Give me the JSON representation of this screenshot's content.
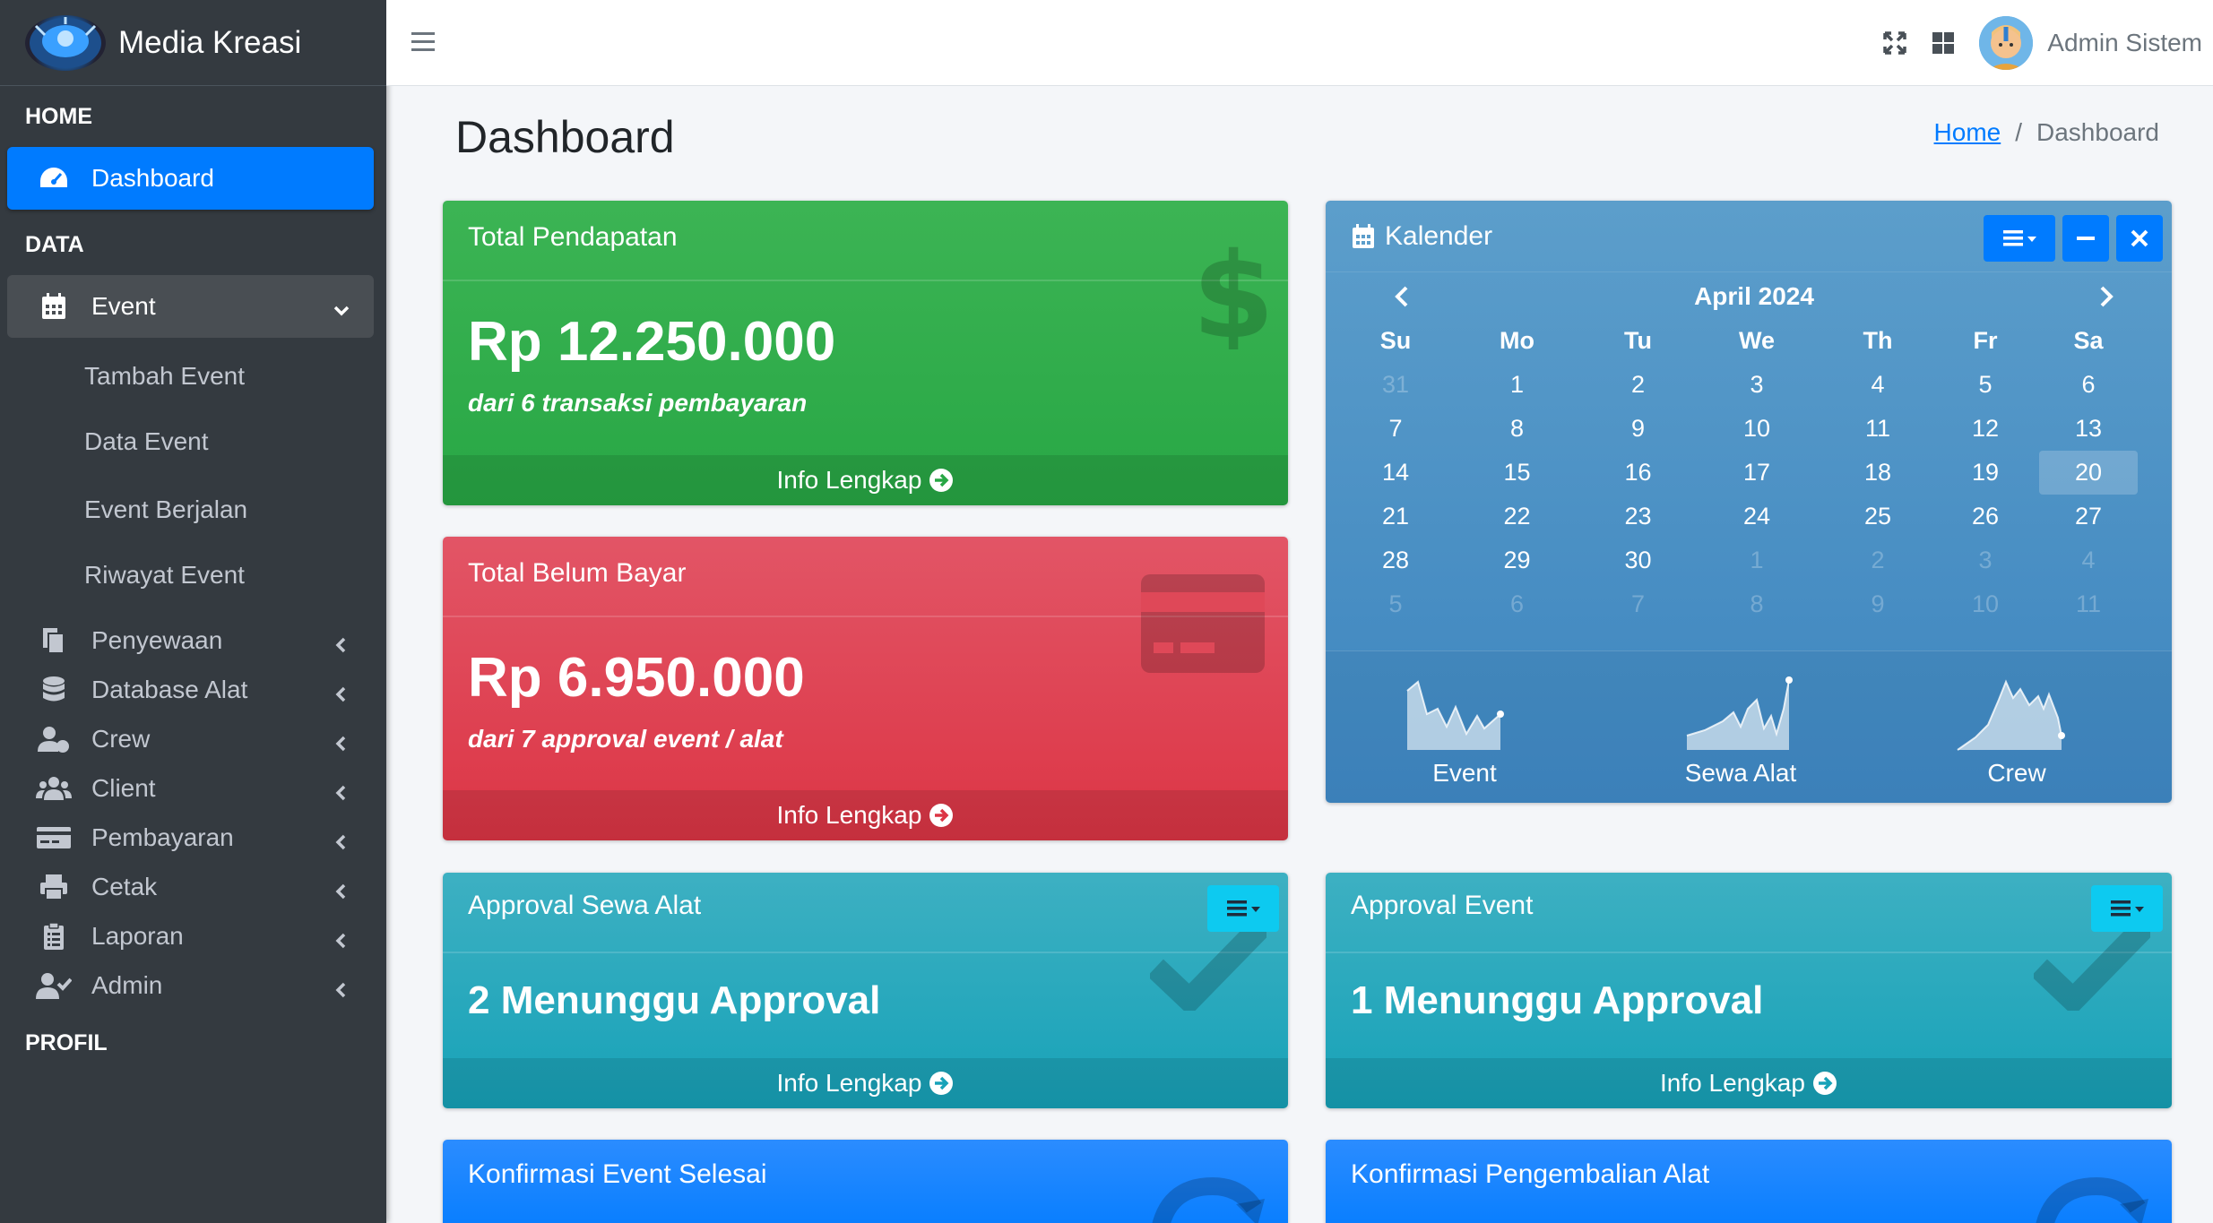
{
  "brand": {
    "name": "Media Kreasi"
  },
  "topbar": {
    "user_name": "Admin Sistem"
  },
  "sidebar": {
    "header_home": "HOME",
    "header_data": "DATA",
    "header_profil": "PROFIL",
    "dashboard": "Dashboard",
    "event": "Event",
    "event_sub": [
      "Tambah Event",
      "Data Event",
      "Event Berjalan",
      "Riwayat Event"
    ],
    "items": [
      "Penyewaan",
      "Database Alat",
      "Crew",
      "Client",
      "Pembayaran",
      "Cetak",
      "Laporan",
      "Admin"
    ]
  },
  "page": {
    "title": "Dashboard",
    "breadcrumb_home": "Home",
    "breadcrumb_sep": "/",
    "breadcrumb_current": "Dashboard"
  },
  "cards": {
    "pendapatan": {
      "title": "Total Pendapatan",
      "value": "Rp 12.250.000",
      "sub": "dari 6 transaksi pembayaran",
      "footer": "Info Lengkap"
    },
    "belum_bayar": {
      "title": "Total Belum Bayar",
      "value": "Rp 6.950.000",
      "sub": "dari 7 approval event / alat",
      "footer": "Info Lengkap"
    },
    "approval_sewa": {
      "title": "Approval Sewa Alat",
      "value": "2 Menunggu Approval",
      "footer": "Info Lengkap"
    },
    "approval_event": {
      "title": "Approval Event",
      "value": "1 Menunggu Approval",
      "footer": "Info Lengkap"
    },
    "konfirmasi_event": {
      "title": "Konfirmasi Event Selesai"
    },
    "konfirmasi_alat": {
      "title": "Konfirmasi Pengembalian Alat"
    }
  },
  "calendar": {
    "title": "Kalender",
    "month": "April 2024",
    "days": [
      "Su",
      "Mo",
      "Tu",
      "We",
      "Th",
      "Fr",
      "Sa"
    ],
    "today": 20,
    "weeks": [
      [
        "31",
        "1",
        "2",
        "3",
        "4",
        "5",
        "6"
      ],
      [
        "7",
        "8",
        "9",
        "10",
        "11",
        "12",
        "13"
      ],
      [
        "14",
        "15",
        "16",
        "17",
        "18",
        "19",
        "20"
      ],
      [
        "21",
        "22",
        "23",
        "24",
        "25",
        "26",
        "27"
      ],
      [
        "28",
        "29",
        "30",
        "1",
        "2",
        "3",
        "4"
      ],
      [
        "5",
        "6",
        "7",
        "8",
        "9",
        "10",
        "11"
      ]
    ],
    "sparklines": [
      {
        "label": "Event"
      },
      {
        "label": "Sewa Alat"
      },
      {
        "label": "Crew"
      }
    ]
  },
  "colors": {
    "sidebar_bg": "#343a40",
    "active": "#007bff",
    "success": "#28a745",
    "danger": "#dc3545",
    "info": "#17a2b8",
    "primary": "#007bff"
  }
}
